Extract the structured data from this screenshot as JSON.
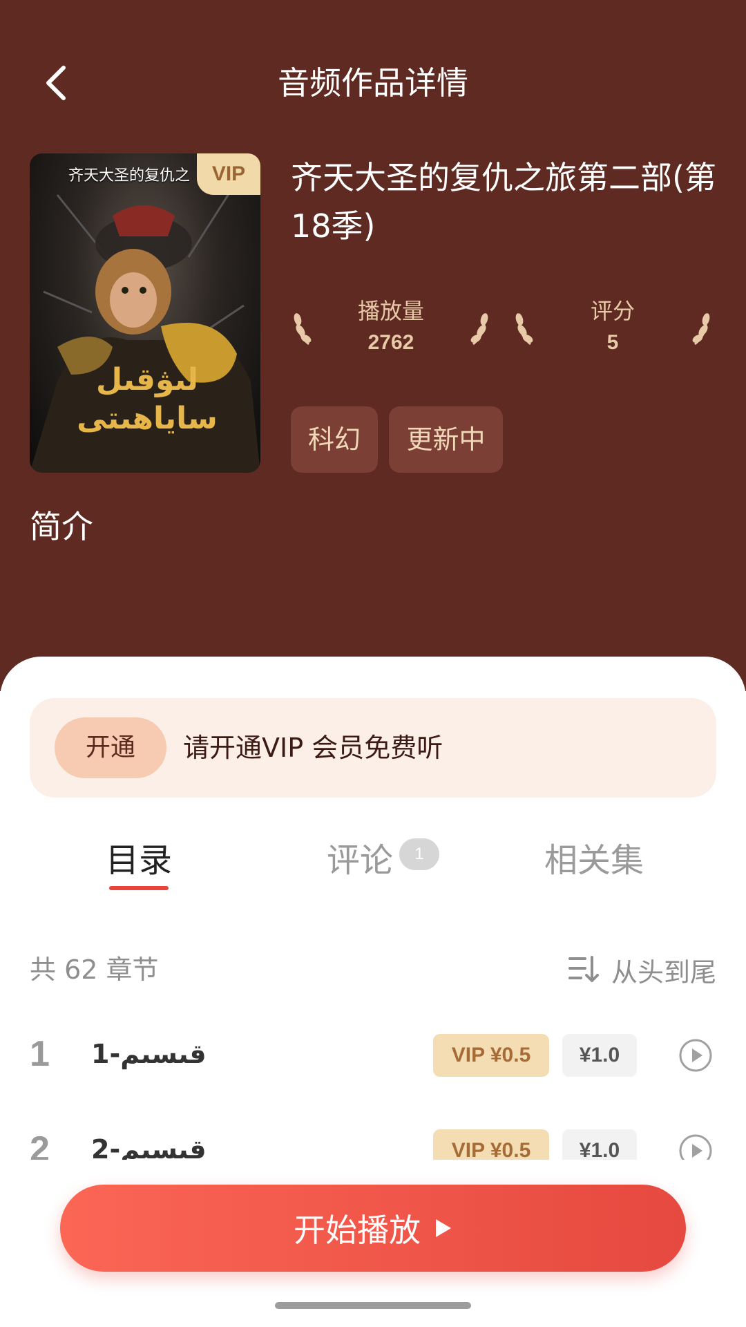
{
  "header": {
    "title": "音频作品详情",
    "back_icon": "chevron-left-icon"
  },
  "work": {
    "cover": {
      "caption": "齐天大圣的复仇之",
      "vip_badge": "VIP",
      "logo_text": "لىۋقىل ساياھىتى"
    },
    "title": "齐天大圣的复仇之旅第二部(第18季)",
    "stats": [
      {
        "label": "播放量",
        "value": "2762"
      },
      {
        "label": "评分",
        "value": "5"
      }
    ],
    "tags": [
      "科幻",
      "更新中"
    ],
    "intro_title": "简介"
  },
  "vip_banner": {
    "button": "开通",
    "text": "请开通VIP 会员免费听"
  },
  "tabs": [
    {
      "label": "目录",
      "active": true
    },
    {
      "label": "评论",
      "badge": "1"
    },
    {
      "label": "相关集"
    }
  ],
  "chapters": {
    "count_text": "共 62 章节",
    "sort_label": "从头到尾",
    "items": [
      {
        "num": "1",
        "title": "قىسىم-1",
        "vip_price": "VIP ¥0.5",
        "price": "¥1.0"
      },
      {
        "num": "2",
        "title": "قىسىم-2",
        "vip_price": "VIP ¥0.5",
        "price": "¥1.0"
      }
    ]
  },
  "play_button": {
    "label": "开始播放"
  },
  "colors": {
    "header_bg": "#5e2a22",
    "accent": "#e8443a",
    "gold": "#e8c9a8"
  }
}
